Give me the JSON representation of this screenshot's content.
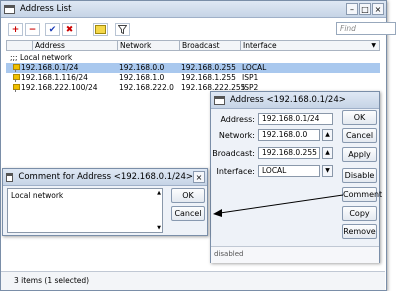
{
  "main_window": {
    "title": "Address List",
    "toolbar": {
      "add": "+",
      "remove": "−",
      "enable": "✔",
      "disable": "✖",
      "comment": "",
      "filter": ""
    },
    "find_placeholder": "Find",
    "columns": [
      "Address",
      "Network",
      "Broadcast",
      "Interface"
    ],
    "group_label": ";;; Local network",
    "rows": [
      {
        "address": "192.168.0.1/24",
        "network": "192.168.0.0",
        "broadcast": "192.168.0.255",
        "interface": "LOCAL",
        "selected": true
      },
      {
        "address": "192.168.1.116/24",
        "network": "192.168.1.0",
        "broadcast": "192.168.1.255",
        "interface": "ISP1",
        "selected": false
      },
      {
        "address": "192.168.222.100/24",
        "network": "192.168.222.0",
        "broadcast": "192.168.222.255",
        "interface": "ISP2",
        "selected": false
      }
    ],
    "status": "3 items (1 selected)"
  },
  "address_dialog": {
    "title": "Address <192.168.0.1/24>",
    "address_label": "Address:",
    "address_value": "192.168.0.1/24",
    "network_label": "Network:",
    "network_value": "192.168.0.0",
    "broadcast_label": "Broadcast:",
    "broadcast_value": "192.168.0.255",
    "interface_label": "Interface:",
    "interface_value": "LOCAL",
    "buttons": {
      "ok": "OK",
      "cancel": "Cancel",
      "apply": "Apply",
      "disable": "Disable",
      "comment": "Comment",
      "copy": "Copy",
      "remove": "Remove"
    },
    "status": "disabled"
  },
  "comment_dialog": {
    "title": "Comment for Address <192.168.0.1/24>",
    "text": "Local network",
    "ok": "OK",
    "cancel": "Cancel"
  },
  "colors": {
    "selection": "#a9c8ee",
    "window_bg": "#eef2f8",
    "arrow": "#000000"
  }
}
